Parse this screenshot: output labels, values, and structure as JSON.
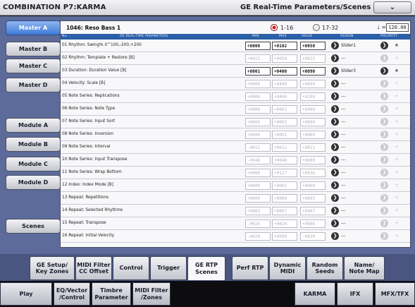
{
  "title": {
    "mode": "COMBINATION P7:KARMA",
    "page": "GE Real-Time Parameters/Scenes",
    "menu_glyph": "⌄"
  },
  "sidebar": [
    {
      "label": "Master A",
      "active": true
    },
    {
      "label": "Master B"
    },
    {
      "label": "Master C"
    },
    {
      "label": "Master D"
    },
    {
      "label": "Module A"
    },
    {
      "label": "Module B"
    },
    {
      "label": "Module C"
    },
    {
      "label": "Module D"
    },
    {
      "label": "Scenes"
    }
  ],
  "program": {
    "name": "1046: Reso Bass 1",
    "range_a": "1-16",
    "range_b": "17-32",
    "tempo_symbol": "♩ =",
    "tempo": "120.00"
  },
  "columns": {
    "no": "No.",
    "param": "GE REAL-TIME PARAMETERS",
    "min": "MIN",
    "max": "MAX",
    "value": "VALUE",
    "assign": "ASSIGN",
    "polarity": "POLARITY"
  },
  "rows": [
    {
      "label": "01  Rhythm: Swing% 0^100,-200,+200",
      "min": "+0000",
      "max": "+0102",
      "value": "+0050",
      "assign": "Slider1",
      "pol": "+",
      "active": true
    },
    {
      "label": "02  Rhythm: Template + Restore [B]",
      "min": "+0015",
      "max": "+0050",
      "value": "+0015",
      "assign": "---",
      "pol": "+",
      "active": false
    },
    {
      "label": "03  Duration: Duration Value [B]",
      "min": "+0001",
      "max": "+0400",
      "value": "+0090",
      "assign": "Slider3",
      "pol": "+",
      "active": true
    },
    {
      "label": "04  Velocity: Scale [B]",
      "min": "+0000",
      "max": "+0400",
      "value": "+0099",
      "assign": "---",
      "pol": "+",
      "active": false
    },
    {
      "label": "05  Note Series: Replications",
      "min": "+0000",
      "max": "+0400",
      "value": "+0200",
      "assign": "---",
      "pol": "+",
      "active": false
    },
    {
      "label": "06  Note Series: Note Type",
      "min": "+0000",
      "max": "+0001",
      "value": "+0000",
      "assign": "---",
      "pol": "+",
      "active": false
    },
    {
      "label": "07  Note Series: Input Sort",
      "min": "+0000",
      "max": "+0001",
      "value": "+0000",
      "assign": "---",
      "pol": "+",
      "active": false
    },
    {
      "label": "08  Note Series: Inversion",
      "min": "+0000",
      "max": "+0001",
      "value": "+0000",
      "assign": "---",
      "pol": "+",
      "active": false
    },
    {
      "label": "09  Note Series: Interval",
      "min": "-0012",
      "max": "+0012",
      "value": "+0012",
      "assign": "---",
      "pol": "+",
      "active": false
    },
    {
      "label": "10  Note Series: Input Transpose",
      "min": "-0048",
      "max": "+0048",
      "value": "+0000",
      "assign": "---",
      "pol": "+",
      "active": false
    },
    {
      "label": "11  Note Series: Wrap Bottom",
      "min": "+0000",
      "max": "+0127",
      "value": "+0036",
      "assign": "---",
      "pol": "+",
      "active": false
    },
    {
      "label": "12  Index: Index Mode [B]",
      "min": "+0000",
      "max": "+0002",
      "value": "+0000",
      "assign": "---",
      "pol": "+",
      "active": false
    },
    {
      "label": "13  Repeat: Repetitions",
      "min": "+0000",
      "max": "+0000",
      "value": "+0005",
      "assign": "---",
      "pol": "+",
      "active": false
    },
    {
      "label": "14  Repeat: Selected Rhythms",
      "min": "+0003",
      "max": "+0007",
      "value": "+0007",
      "assign": "---",
      "pol": "+",
      "active": false
    },
    {
      "label": "15  Repeat: Transpose",
      "min": "-0024",
      "max": "+0024",
      "value": "+0006",
      "assign": "---",
      "pol": "+",
      "active": false
    },
    {
      "label": "16  Repeat: Initial Velocity",
      "min": "-0020",
      "max": "+0000",
      "value": "-0020",
      "assign": "---",
      "pol": "+",
      "active": false
    }
  ],
  "tabs_top": [
    {
      "label": "GE Setup/\nKey Zones"
    },
    {
      "label": "MIDI Filter\nCC Offset"
    },
    {
      "label": "Control"
    },
    {
      "label": "Trigger"
    },
    {
      "label": "GE RTP\nScenes",
      "active": true
    },
    {
      "label": "Perf RTP"
    },
    {
      "label": "Dynamic\nMIDI"
    },
    {
      "label": "Random\nSeeds"
    },
    {
      "label": "Name/\nNote Map"
    }
  ],
  "tabs_bottom": [
    {
      "label": "Play"
    },
    {
      "label": "EQ/Vector\n/Control"
    },
    {
      "label": "Timbre\nParameter"
    },
    {
      "label": "MIDI Filter\n/Zones"
    },
    {
      "label": "KARMA"
    },
    {
      "label": "IFX"
    },
    {
      "label": "MFX/TFX"
    }
  ]
}
